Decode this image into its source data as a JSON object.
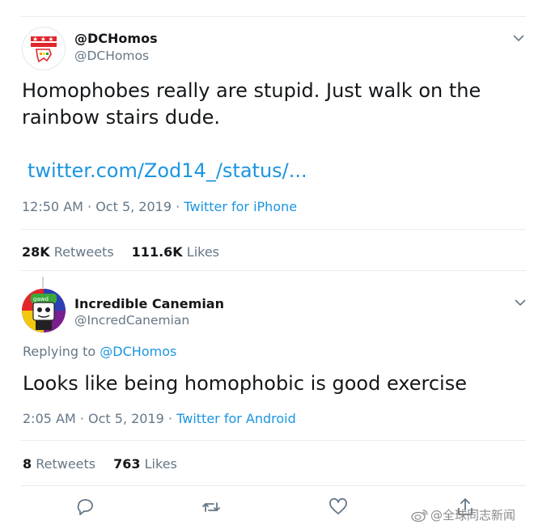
{
  "tweet": {
    "display_name": "@DCHomos",
    "handle": "@DCHomos",
    "text": "Homophobes really are stupid. Just walk on the rainbow stairs dude.",
    "link": "twitter.com/Zod14_/status/...",
    "time": "12:50 AM · Oct 5, 2019 · ",
    "source": "Twitter for iPhone",
    "retweets_count": "28K",
    "retweets_label": "Retweets",
    "likes_count": "111.6K",
    "likes_label": "Likes"
  },
  "reply": {
    "display_name": "Incredible Canemian",
    "handle": "@IncredCanemian",
    "replying_label": "Replying to ",
    "replying_user": "@DCHomos",
    "text": "Looks like being homophobic is good exercise",
    "time": "2:05 AM · Oct 5, 2019 · ",
    "source": "Twitter for Android",
    "retweets_count": "8",
    "retweets_label": "Retweets",
    "likes_count": "763",
    "likes_label": "Likes"
  },
  "actions": [
    "reply-icon",
    "retweet-icon",
    "like-icon",
    "share-icon"
  ],
  "watermark": {
    "text": "@全球同志新闻"
  },
  "colors": {
    "link": "#1b95e0",
    "muted": "#657786",
    "text": "#14171a",
    "divider": "#e6ecf0"
  }
}
